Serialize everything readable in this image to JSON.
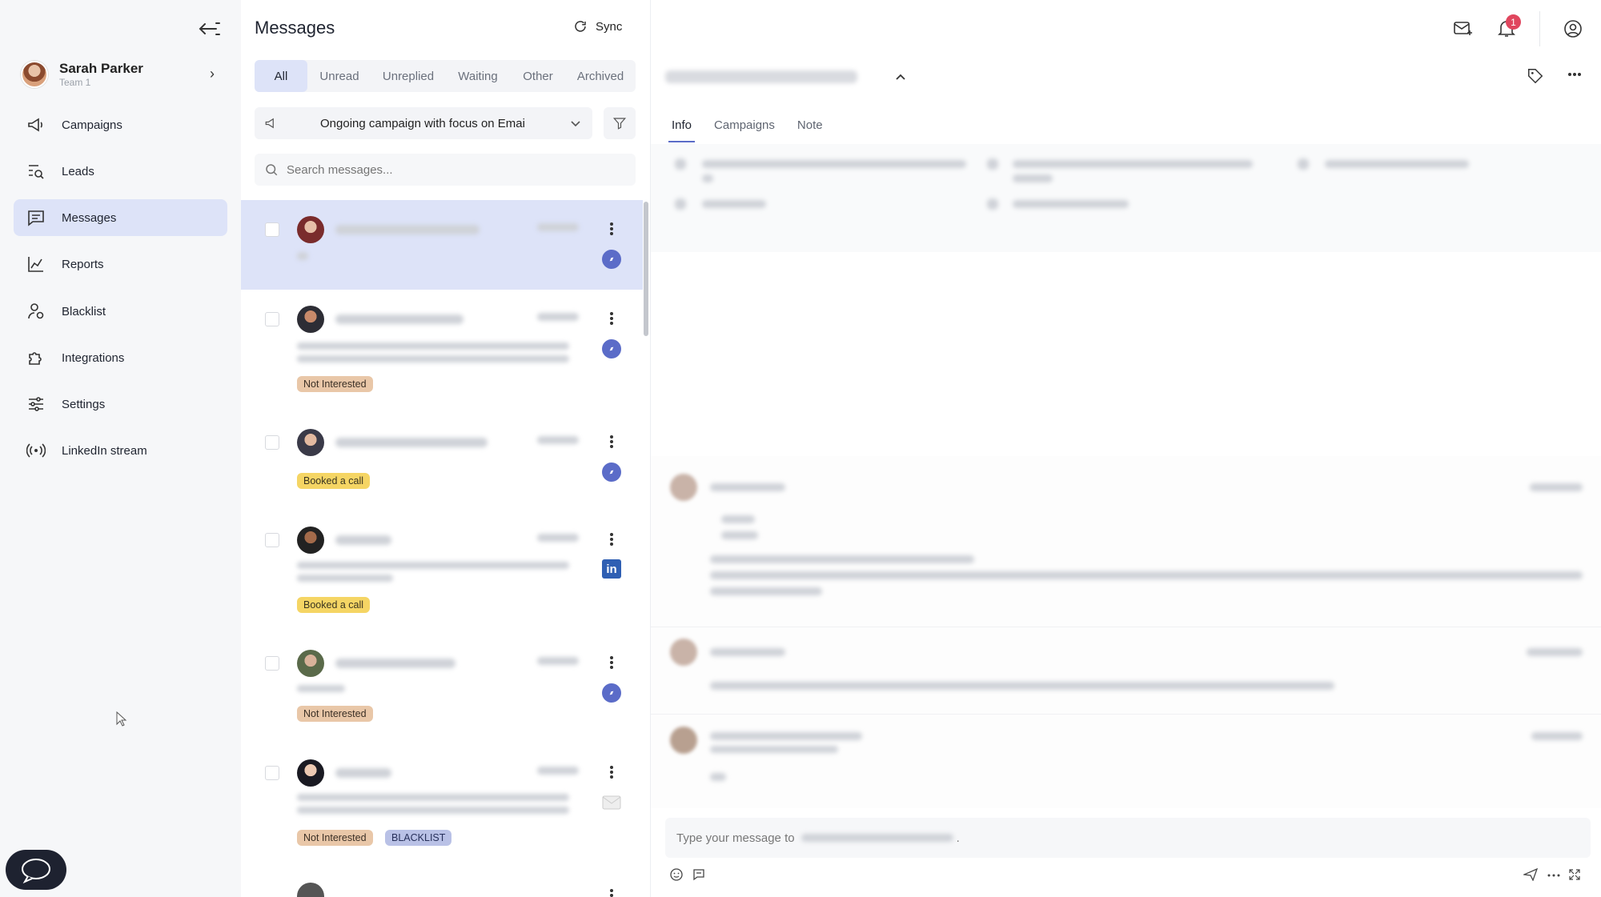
{
  "sidebar": {
    "user": {
      "name": "Sarah Parker",
      "team": "Team 1"
    },
    "items": [
      {
        "label": "Campaigns",
        "icon": "megaphone-icon"
      },
      {
        "label": "Leads",
        "icon": "search-list-icon"
      },
      {
        "label": "Messages",
        "icon": "message-icon",
        "active": true
      },
      {
        "label": "Reports",
        "icon": "chart-icon"
      },
      {
        "label": "Blacklist",
        "icon": "user-block-icon"
      },
      {
        "label": "Integrations",
        "icon": "puzzle-icon"
      },
      {
        "label": "Settings",
        "icon": "sliders-icon"
      },
      {
        "label": "LinkedIn stream",
        "icon": "broadcast-icon"
      }
    ]
  },
  "messages": {
    "title": "Messages",
    "sync_label": "Sync",
    "tabs": [
      "All",
      "Unread",
      "Unreplied",
      "Waiting",
      "Other",
      "Archived"
    ],
    "active_tab": "All",
    "campaign_select": "Ongoing campaign with focus on Emai",
    "search_placeholder": "Search messages...",
    "conversations": [
      {
        "tags": [],
        "channel": "compass-icon",
        "selected": true
      },
      {
        "tags": [
          "Not Interested"
        ],
        "channel": "compass-icon"
      },
      {
        "tags": [
          "Booked a call"
        ],
        "channel": "compass-icon"
      },
      {
        "tags": [
          "Booked a call"
        ],
        "channel": "linkedin-icon"
      },
      {
        "tags": [
          "Not Interested"
        ],
        "channel": "compass-icon"
      },
      {
        "tags": [
          "Not Interested",
          "BLACKLIST"
        ],
        "channel": "mail-icon"
      }
    ]
  },
  "detail": {
    "tabs": [
      "Info",
      "Campaigns",
      "Note"
    ],
    "active_tab": "Info",
    "compose_placeholder": "Type your message to",
    "notification_count": "1"
  },
  "colors": {
    "accent": "#5b6cc8",
    "active_bg": "#dde3f8",
    "tag_not_interested": "#e9c7a8",
    "tag_booked": "#f5d564",
    "tag_blacklist": "#b9c1e6"
  }
}
